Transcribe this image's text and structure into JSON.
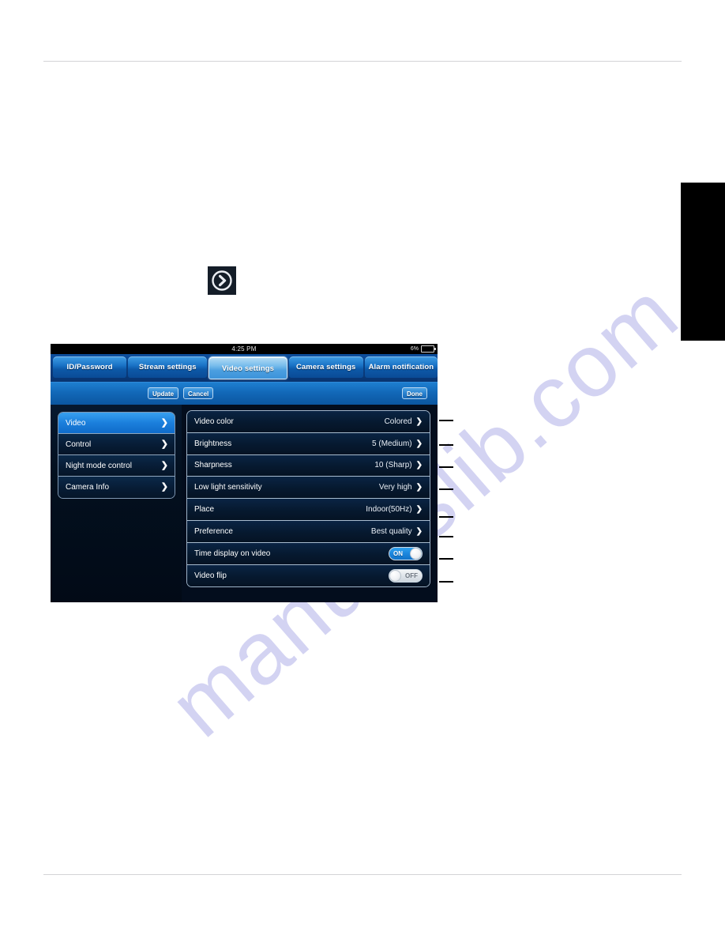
{
  "watermark": {
    "text": "manualslib.com"
  },
  "page_icon": {
    "name": "chevron-right-circle-icon",
    "glyph": "›"
  },
  "device": {
    "status_bar": {
      "time": "4:25 PM",
      "battery_percent": "6%"
    },
    "tabs": [
      {
        "label": "ID/Password",
        "active": false
      },
      {
        "label": "Stream settings",
        "active": false
      },
      {
        "label": "Video settings",
        "active": true
      },
      {
        "label": "Camera settings",
        "active": false
      },
      {
        "label": "Alarm notification",
        "active": false
      }
    ],
    "toolbar": {
      "update_label": "Update",
      "cancel_label": "Cancel",
      "done_label": "Done"
    },
    "sidebar": {
      "items": [
        {
          "label": "Video",
          "selected": true
        },
        {
          "label": "Control",
          "selected": false
        },
        {
          "label": "Night mode control",
          "selected": false
        },
        {
          "label": "Camera Info",
          "selected": false
        }
      ]
    },
    "settings_rows": [
      {
        "label": "Video color",
        "value": "Colored",
        "type": "chevron"
      },
      {
        "label": "Brightness",
        "value": "5 (Medium)",
        "type": "chevron"
      },
      {
        "label": "Sharpness",
        "value": "10 (Sharp)",
        "type": "chevron"
      },
      {
        "label": "Low light sensitivity",
        "value": "Very high",
        "type": "chevron"
      },
      {
        "label": "Place",
        "value": "Indoor(50Hz)",
        "type": "chevron"
      },
      {
        "label": "Preference",
        "value": "Best quality",
        "type": "chevron"
      },
      {
        "label": "Time display on video",
        "value": "ON",
        "type": "toggle-on"
      },
      {
        "label": "Video flip",
        "value": "OFF",
        "type": "toggle-off"
      }
    ],
    "chevron_glyph": "❯"
  },
  "colors": {
    "accent_blue": "#1b86de",
    "tab_active": "#77bcec",
    "panel_dark": "#06192f",
    "watermark": "#ccccf0",
    "rule": "#d4d4d6"
  }
}
